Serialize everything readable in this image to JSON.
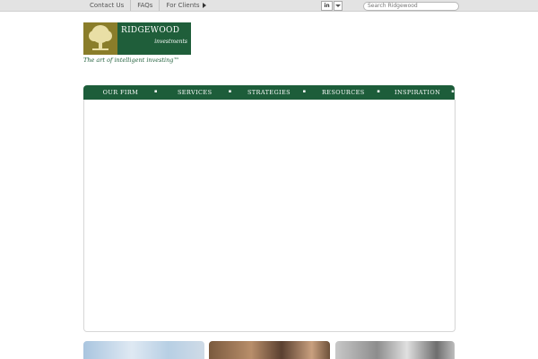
{
  "topbar": {
    "links": [
      "Contact Us",
      "FAQs",
      "For Clients"
    ],
    "social_label": "in",
    "search_placeholder": "Search Ridgewood"
  },
  "logo": {
    "name": "RIDGEWOOD",
    "sub": "investments",
    "tagline": "The art of intelligent investing™"
  },
  "nav": {
    "items": [
      "OUR FIRM",
      "SERVICES",
      "STRATEGIES",
      "RESOURCES",
      "INSPIRATION"
    ]
  },
  "colors": {
    "brand_green": "#1d5d3a",
    "tree_gold": "#8a7d2a",
    "topbar": "#e3e3e3"
  }
}
